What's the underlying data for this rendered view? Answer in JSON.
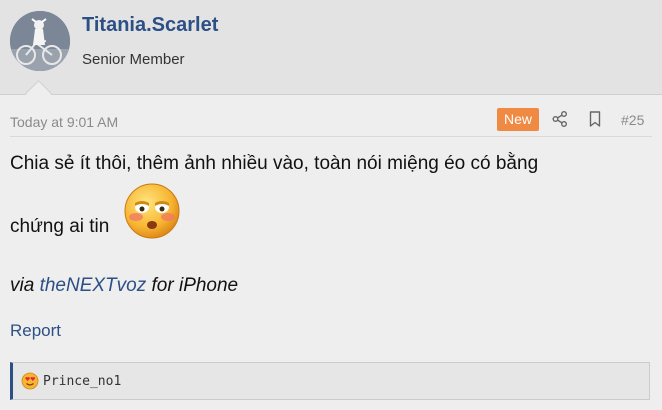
{
  "user": {
    "name": "Titania.Scarlet",
    "title": "Senior Member"
  },
  "post": {
    "date": "Today at 9:01 AM",
    "badge": "New",
    "number": "#25",
    "body_line1": "Chia sẻ ít thôi, thêm ảnh nhiều vào, toàn nói miệng éo có bằng",
    "body_line2": "chứng ai tin",
    "emoji": "flushed-face-emoji",
    "via_prefix": "via",
    "via_app": "theNEXTvoz",
    "via_suffix": "for iPhone"
  },
  "actions": {
    "report": "Report"
  },
  "reactions": {
    "icon": "heart-eyes-face-icon",
    "user": "Prince_no1"
  },
  "colors": {
    "accent": "#2c4f86",
    "badge": "#f08a42",
    "muted": "#8a8a8a"
  }
}
